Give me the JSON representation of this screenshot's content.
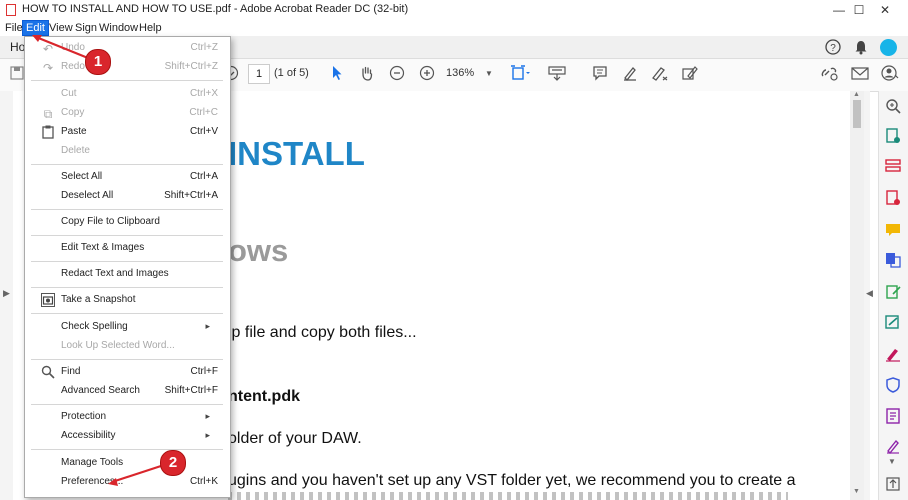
{
  "window": {
    "title": "HOW TO INSTALL AND HOW TO USE.pdf - Adobe Acrobat Reader DC (32-bit)",
    "minimize": "—",
    "maximize": "☐",
    "close": "✕"
  },
  "menubar": {
    "file": "File",
    "edit": "Edit",
    "view": "View",
    "sign": "Sign",
    "window": "Window",
    "help": "Help"
  },
  "tabs": {
    "home": "Ho"
  },
  "toolbar": {
    "page_number": "1",
    "page_count": "(1 of 5)",
    "zoom": "136%"
  },
  "document": {
    "heading1": "INSTALL",
    "heading2": "ows",
    "line1": "ip file and copy both files...",
    "line2": "ntent.pdk",
    "line3": "older of your DAW.",
    "line4": "ugins and you haven't set up any VST folder yet, we recommend you to create a"
  },
  "edit_menu": {
    "undo": {
      "label": "Undo",
      "shortcut": "Ctrl+Z"
    },
    "redo": {
      "label": "Redo",
      "shortcut": "Shift+Ctrl+Z"
    },
    "cut": {
      "label": "Cut",
      "shortcut": "Ctrl+X"
    },
    "copy": {
      "label": "Copy",
      "shortcut": "Ctrl+C"
    },
    "paste": {
      "label": "Paste",
      "shortcut": "Ctrl+V"
    },
    "delete": {
      "label": "Delete"
    },
    "select_all": {
      "label": "Select All",
      "shortcut": "Ctrl+A"
    },
    "deselect_all": {
      "label": "Deselect All",
      "shortcut": "Shift+Ctrl+A"
    },
    "copy_file": {
      "label": "Copy File to Clipboard"
    },
    "edit_text": {
      "label": "Edit Text & Images"
    },
    "redact": {
      "label": "Redact Text and Images"
    },
    "snapshot": {
      "label": "Take a Snapshot"
    },
    "check_spelling": {
      "label": "Check Spelling"
    },
    "lookup": {
      "label": "Look Up Selected Word..."
    },
    "find": {
      "label": "Find",
      "shortcut": "Ctrl+F"
    },
    "advanced_search": {
      "label": "Advanced Search",
      "shortcut": "Shift+Ctrl+F"
    },
    "protection": {
      "label": "Protection"
    },
    "accessibility": {
      "label": "Accessibility"
    },
    "manage_tools": {
      "label": "Manage Tools"
    },
    "preferences": {
      "label": "Preferences...",
      "shortcut": "Ctrl+K"
    }
  },
  "annotations": {
    "badge1": "1",
    "badge2": "2"
  },
  "colors": {
    "accent": "#1a73e8",
    "heading_blue": "#1f86c7",
    "annotation_red": "#d9262c"
  },
  "icons": [
    "pdf-icon",
    "help-icon",
    "bell-icon",
    "avatar",
    "hand-icon",
    "pointer-icon",
    "zoom-out-icon",
    "zoom-in-icon",
    "comment-icon",
    "highlight-icon",
    "sign-icon",
    "link-icon",
    "mail-icon",
    "user-icon"
  ]
}
